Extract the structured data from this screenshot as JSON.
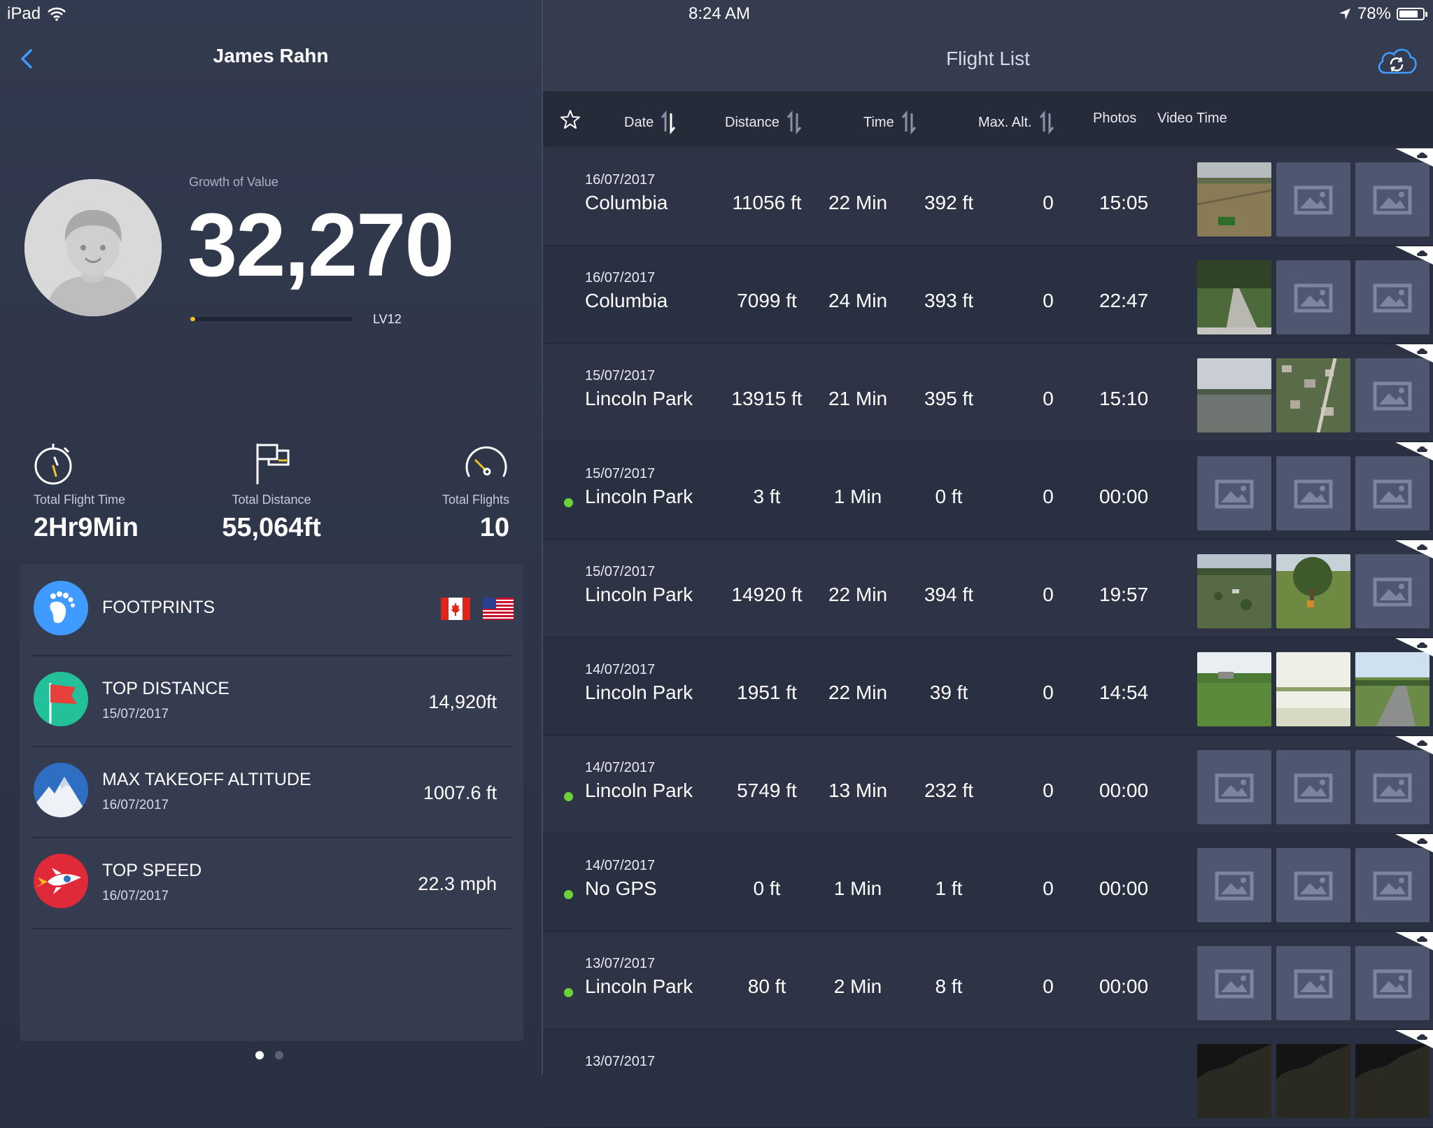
{
  "status_bar": {
    "device": "iPad",
    "time": "8:24 AM",
    "battery": "78%"
  },
  "profile": {
    "name": "James Rahn",
    "growth_label": "Growth of Value",
    "growth_value": "32,270",
    "level": "LV12",
    "level_progress_fraction": 0.03
  },
  "stats": [
    {
      "label": "Total Flight Time",
      "value": "2Hr9Min",
      "icon": "stopwatch-icon"
    },
    {
      "label": "Total Distance",
      "value": "55,064ft",
      "icon": "flag-icon"
    },
    {
      "label": "Total Flights",
      "value": "10",
      "icon": "speedometer-icon"
    }
  ],
  "records": [
    {
      "title": "FOOTPRINTS",
      "icon": "footprint-icon",
      "flags": [
        "canada-flag",
        "usa-flag"
      ]
    },
    {
      "title": "TOP DISTANCE",
      "date": "15/07/2017",
      "value": "14,920ft",
      "icon": "red-flag-icon"
    },
    {
      "title": "MAX TAKEOFF ALTITUDE",
      "date": "16/07/2017",
      "value": "1007.6 ft",
      "icon": "mountain-icon"
    },
    {
      "title": "TOP SPEED",
      "date": "16/07/2017",
      "value": "22.3 mph",
      "icon": "rocket-icon"
    }
  ],
  "flight_list": {
    "title": "Flight List",
    "columns": [
      "Date",
      "Distance",
      "Time",
      "Max. Alt.",
      "Photos",
      "Video Time"
    ],
    "rows": [
      {
        "date": "16/07/2017",
        "location": "Columbia",
        "distance": "11056 ft",
        "time": "22 Min",
        "max_alt": "392 ft",
        "photos": "0",
        "video_time": "15:05",
        "live": false,
        "thumbs": [
          "field",
          "ph",
          "ph"
        ]
      },
      {
        "date": "16/07/2017",
        "location": "Columbia",
        "distance": "7099 ft",
        "time": "24 Min",
        "max_alt": "393 ft",
        "photos": "0",
        "video_time": "22:47",
        "live": false,
        "thumbs": [
          "road",
          "ph",
          "ph"
        ]
      },
      {
        "date": "15/07/2017",
        "location": "Lincoln Park",
        "distance": "13915 ft",
        "time": "21 Min",
        "max_alt": "395 ft",
        "photos": "0",
        "video_time": "15:10",
        "live": false,
        "thumbs": [
          "lot",
          "town",
          "ph"
        ]
      },
      {
        "date": "15/07/2017",
        "location": "Lincoln Park",
        "distance": "3 ft",
        "time": "1 Min",
        "max_alt": "0 ft",
        "photos": "0",
        "video_time": "00:00",
        "live": true,
        "thumbs": [
          "ph",
          "ph",
          "ph"
        ]
      },
      {
        "date": "15/07/2017",
        "location": "Lincoln Park",
        "distance": "14920 ft",
        "time": "22 Min",
        "max_alt": "394 ft",
        "photos": "0",
        "video_time": "19:57",
        "live": false,
        "thumbs": [
          "park",
          "tree",
          "ph"
        ]
      },
      {
        "date": "14/07/2017",
        "location": "Lincoln Park",
        "distance": "1951 ft",
        "time": "22 Min",
        "max_alt": "39 ft",
        "photos": "0",
        "video_time": "14:54",
        "live": false,
        "thumbs": [
          "lawn",
          "bright",
          "street"
        ]
      },
      {
        "date": "14/07/2017",
        "location": "Lincoln Park",
        "distance": "5749 ft",
        "time": "13 Min",
        "max_alt": "232 ft",
        "photos": "0",
        "video_time": "00:00",
        "live": true,
        "thumbs": [
          "ph",
          "ph",
          "ph"
        ]
      },
      {
        "date": "14/07/2017",
        "location": "No GPS",
        "distance": "0 ft",
        "time": "1 Min",
        "max_alt": "1 ft",
        "photos": "0",
        "video_time": "00:00",
        "live": true,
        "thumbs": [
          "ph",
          "ph",
          "ph"
        ]
      },
      {
        "date": "13/07/2017",
        "location": "Lincoln Park",
        "distance": "80 ft",
        "time": "2 Min",
        "max_alt": "8 ft",
        "photos": "0",
        "video_time": "00:00",
        "live": true,
        "thumbs": [
          "ph",
          "ph",
          "ph"
        ]
      },
      {
        "date": "13/07/2017",
        "location": "",
        "distance": "",
        "time": "",
        "max_alt": "",
        "photos": "",
        "video_time": "",
        "live": false,
        "thumbs": [
          "dark",
          "dark",
          "dark"
        ]
      }
    ]
  },
  "colors": {
    "accent": "#3f9bff",
    "live_dot": "#6fd13a",
    "level_bar": "#f3c31f"
  },
  "pager": {
    "pages": 2,
    "current": 0
  }
}
